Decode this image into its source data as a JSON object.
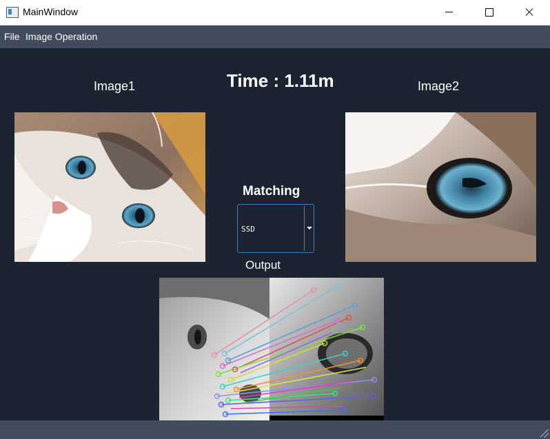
{
  "window": {
    "title": "MainWindow"
  },
  "menu": {
    "items": [
      "File",
      "Image Operation"
    ]
  },
  "labels": {
    "image1": "Image1",
    "image2": "Image2",
    "time": "Time : 1.11m",
    "matching": "Matching",
    "output": "Output"
  },
  "matching_combo": {
    "selected": "SSD"
  },
  "icons": {
    "app": "app-window-icon",
    "minimize": "minimize-icon",
    "maximize": "maximize-icon",
    "close": "close-icon",
    "dropdown": "chevron-down-icon"
  }
}
